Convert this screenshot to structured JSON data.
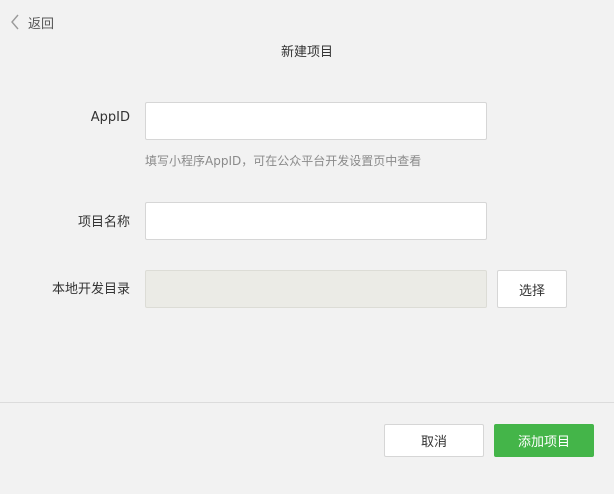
{
  "header": {
    "back_label": "返回",
    "title": "新建项目"
  },
  "form": {
    "appid": {
      "label": "AppID",
      "value": "",
      "hint": "填写小程序AppID，可在公众平台开发设置页中查看"
    },
    "project_name": {
      "label": "项目名称",
      "value": ""
    },
    "local_dir": {
      "label": "本地开发目录",
      "value": "",
      "choose_label": "选择"
    }
  },
  "footer": {
    "cancel_label": "取消",
    "submit_label": "添加项目"
  },
  "colors": {
    "primary": "#44b549",
    "background": "#f2f2f2",
    "disabled_field": "#ebebe6"
  },
  "icons": {
    "back": "chevron-left-icon"
  }
}
